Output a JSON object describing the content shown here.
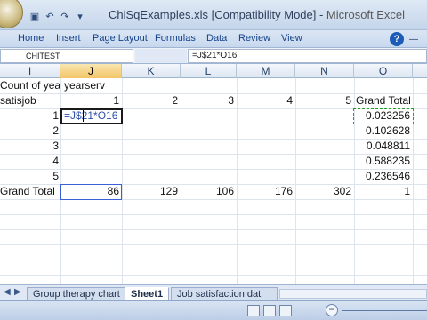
{
  "window": {
    "title": "ChiSqExamples.xls  [Compatibility Mode] - ",
    "app_name": "Microsoft Excel"
  },
  "ribbon": {
    "tabs": [
      "Home",
      "Insert",
      "Page Layout",
      "Formulas",
      "Data",
      "Review",
      "View"
    ]
  },
  "formula_bar": {
    "name_box": "CHITEST",
    "formula": "=J$21*O16"
  },
  "columns": [
    "I",
    "J",
    "K",
    "L",
    "M",
    "N",
    "O"
  ],
  "sheet": {
    "header_label": "Count of yea",
    "header_field": "yearserv",
    "row_field": "satisjob",
    "col_values": [
      "1",
      "2",
      "3",
      "4",
      "5"
    ],
    "grand_total_col": "Grand Total",
    "row_labels": [
      "1",
      "2",
      "3",
      "4",
      "5"
    ],
    "editing_cell": "=J$21*O16",
    "grand_total_values": [
      "0.023256",
      "0.102628",
      "0.048811",
      "0.588235",
      "0.236546"
    ],
    "grand_total_row_label": "Grand Total",
    "grand_total_row": [
      "86",
      "129",
      "106",
      "176",
      "302",
      "1"
    ]
  },
  "sheet_tabs": [
    "Group therapy chart",
    "Sheet1",
    "Job satisfaction dat"
  ],
  "active_sheet": "Sheet1"
}
